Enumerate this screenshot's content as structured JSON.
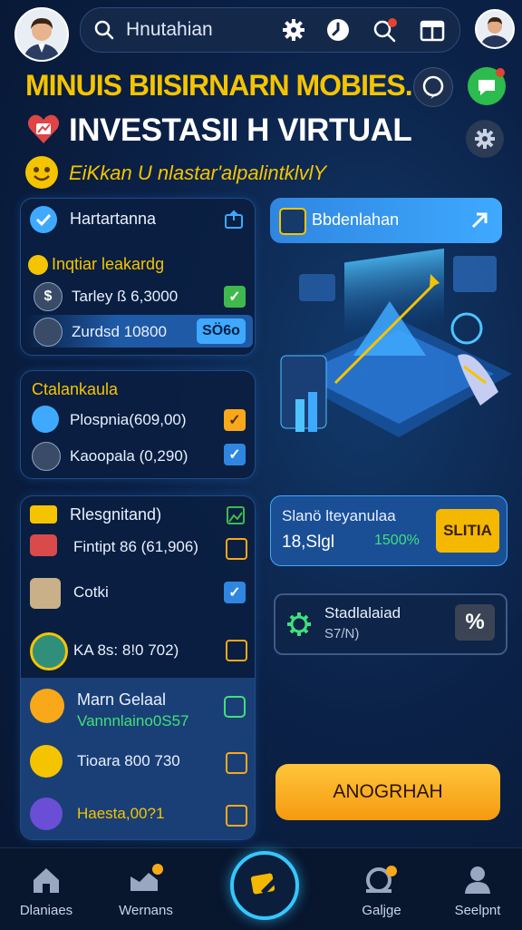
{
  "header": {
    "search_text": "Hnutahian"
  },
  "title": {
    "line1": "MINUIS BIISIRNARN MOBIES.",
    "line2": "INVESTASII H VIRTUAL",
    "line3": "EiKkan U nlastar'alpalintklvlY"
  },
  "left_panel_1": {
    "title": "Hartartanna",
    "subtitle": "Inqtiar leakardg",
    "row1": "Tarley ß 6,3000",
    "row2": "Zurdsd 10800",
    "row2_badge": "SÖ6o"
  },
  "left_panel_2": {
    "title": "Ctalankaula",
    "row1": "Plospnia(609,00)",
    "row2": "Kaoopala (0,290)"
  },
  "left_panel_3": {
    "title": "Rlesgnitand)",
    "row1": "Fintipt 86 (61,906)",
    "row2": "Cotki",
    "row3": "KA 8s: 8!0 702)",
    "row4_title": "Marn Gelaal",
    "row4_sub": "Vannnlaino0S57",
    "row5": "Tioara 800 730",
    "row6": "Haesta,00?1"
  },
  "promo_card": {
    "label": "Bbdenlahan"
  },
  "stats_card": {
    "label": "Slanö lteyanulaa",
    "value": "18,Slgl",
    "change": "1500%",
    "button": "SLITIA"
  },
  "small_card": {
    "title": "Stadlalaiad",
    "value": "S7/N)",
    "badge": "%"
  },
  "cta_button": {
    "label": "ANOGRHAH"
  },
  "bottom_nav": {
    "item1": "Dlaniaes",
    "item2": "Wernans",
    "item3": "Galjge",
    "item4": "Seelpnt"
  },
  "colors": {
    "accent_yellow": "#f5c400",
    "accent_blue": "#3fa9ff",
    "cta_orange": "#f9a81a",
    "positive_green": "#3fe07a"
  }
}
